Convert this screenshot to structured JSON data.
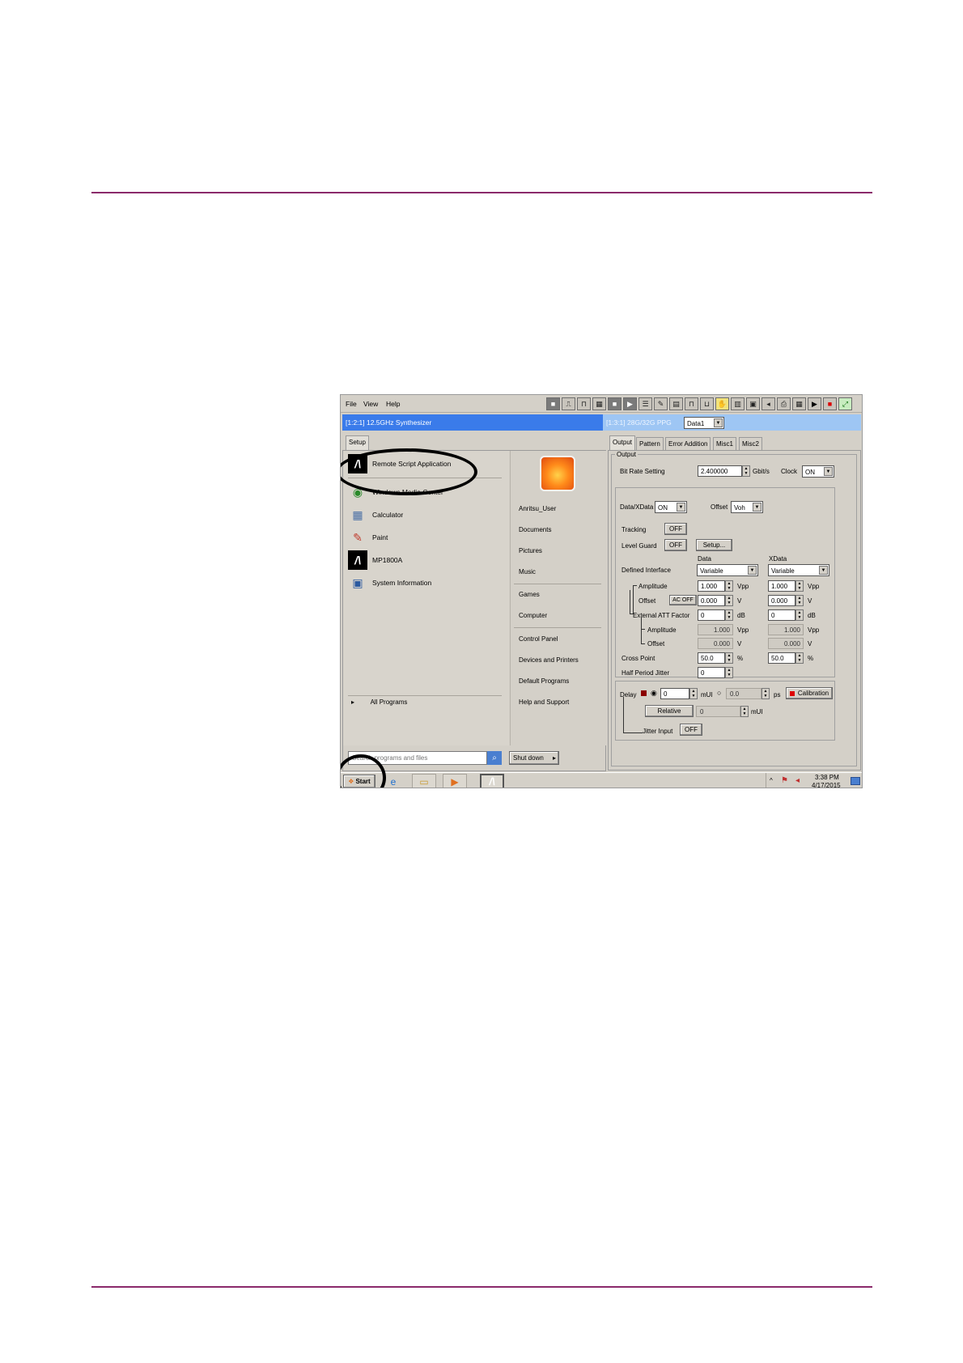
{
  "menu": {
    "file": "File",
    "view": "View",
    "help": "Help"
  },
  "toolbar_icons": [
    "stop-icon",
    "pattern-icon",
    "waveform-icon",
    "grid-icon",
    "block-icon",
    "block-arrow-icon",
    "list-icon",
    "edit-icon",
    "data-icon",
    "pulse-icon",
    "pulse-alt-icon",
    "hand-icon",
    "table-icon",
    "save-icon",
    "speaker-icon",
    "print-icon",
    "chart-icon",
    "run-icon",
    "stop-red-icon",
    "export-icon"
  ],
  "title_left": "[1:2:1] 12.5GHz Synthesizer",
  "title_right": "[1:3:1] 28G/32G PPG",
  "data_select": "Data1",
  "setup_tab": "Setup",
  "tabs": [
    "Output",
    "Pattern",
    "Error Addition",
    "Misc1",
    "Misc2"
  ],
  "start_menu": {
    "pinned": {
      "label": "Remote Script Application",
      "icon": "anritsu-icon"
    },
    "programs": [
      {
        "label": "Windows Media Center",
        "icon": "windows-media-center-icon"
      },
      {
        "label": "Calculator",
        "icon": "calculator-icon"
      },
      {
        "label": "Paint",
        "icon": "paint-icon"
      },
      {
        "label": "MP1800A",
        "icon": "anritsu-icon"
      },
      {
        "label": "System Information",
        "icon": "system-information-icon"
      }
    ],
    "all_programs": "All Programs",
    "search_placeholder": "Search programs and files",
    "shutdown": "Shut down",
    "right": {
      "user": "Anritsu_User",
      "group1": [
        "Documents",
        "Pictures",
        "Music"
      ],
      "group2": [
        "Games",
        "Computer"
      ],
      "group3": [
        "Control Panel",
        "Devices and Printers",
        "Default Programs",
        "Help and Support"
      ]
    }
  },
  "output": {
    "group_label": "Output",
    "bit_rate_label": "Bit Rate Setting",
    "bit_rate_value": "2.400000",
    "bit_rate_unit": "Gbit/s",
    "clock_label": "Clock",
    "clock_value": "ON",
    "data_xdata_label": "Data/XData",
    "data_xdata_value": "ON",
    "offset_label": "Offset",
    "offset_value": "Voh",
    "tracking_label": "Tracking",
    "tracking_value": "OFF",
    "level_guard_label": "Level Guard",
    "level_guard_value": "OFF",
    "setup_button": "Setup...",
    "data_col": "Data",
    "xdata_col": "XData",
    "defined_interface_label": "Defined Interface",
    "defined_interface_data": "Variable",
    "defined_interface_xdata": "Variable",
    "amplitude_label": "Amplitude",
    "amplitude_data": "1.000",
    "amplitude_xdata": "1.000",
    "amplitude_unit": "Vpp",
    "offset_row_label": "Offset",
    "ac_off": "AC OFF",
    "offset_data": "0.000",
    "offset_xdata": "0.000",
    "volt_unit": "V",
    "ext_att_label": "External ATT Factor",
    "ext_att_data": "0",
    "ext_att_xdata": "0",
    "db_unit": "dB",
    "sub_amplitude_label": "Amplitude",
    "sub_amplitude_data": "1.000",
    "sub_amplitude_xdata": "1.000",
    "sub_offset_label": "Offset",
    "sub_offset_data": "0.000",
    "sub_offset_xdata": "0.000",
    "cross_point_label": "Cross Point",
    "cross_point_data": "50.0",
    "cross_point_xdata": "50.0",
    "percent_unit": "%",
    "half_period_label": "Half Period Jitter",
    "half_period_value": "0",
    "delay_label": "Delay",
    "delay_mui_value": "0",
    "mui_unit": "mUI",
    "delay_ps_value": "0.0",
    "ps_unit": "ps",
    "calibration_button": "Calibration",
    "relative_button": "Relative",
    "relative_value": "0",
    "jitter_input_label": "Jitter Input",
    "jitter_input_value": "OFF"
  },
  "taskbar": {
    "start": "Start",
    "icons": [
      "internet-explorer-icon",
      "file-explorer-icon",
      "media-player-icon",
      "anritsu-icon"
    ],
    "time": "3:38 PM",
    "date": "4/17/2015"
  }
}
